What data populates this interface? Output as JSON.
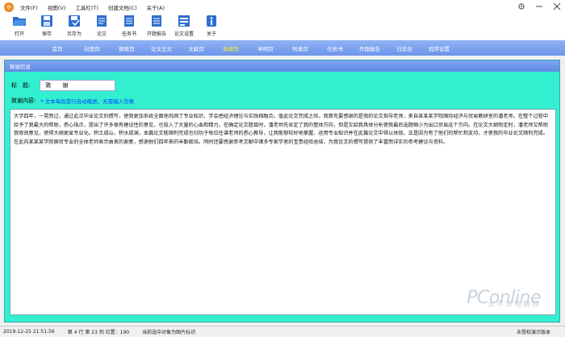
{
  "menu": {
    "logo_letter": "小",
    "items": [
      "文件(F)",
      "视图(V)",
      "工具栏(T)",
      "创建文档(C)",
      "关于(A)"
    ]
  },
  "toolbar": {
    "items": [
      {
        "label": "打开",
        "icon": "folder-open-icon"
      },
      {
        "label": "保存",
        "icon": "save-icon"
      },
      {
        "label": "另存为",
        "icon": "save-as-icon"
      },
      {
        "label": "论文",
        "icon": "document-icon"
      },
      {
        "label": "任务书",
        "icon": "task-book-icon"
      },
      {
        "label": "开题报告",
        "icon": "report-icon"
      },
      {
        "label": "论文设置",
        "icon": "settings-doc-icon"
      },
      {
        "label": "关于",
        "icon": "info-icon"
      }
    ]
  },
  "nav": {
    "items": [
      "首页",
      "封面页",
      "摘要页",
      "论文正文",
      "文献页",
      "致谢页",
      "申明页",
      "附录页",
      "任务书",
      "开题报告",
      "日志台",
      "程序设置"
    ],
    "active_index": 5
  },
  "panel": {
    "header": "致谢信息",
    "title_label": "标　题:",
    "title_value": "致　　谢",
    "content_label": "致谢内容:",
    "hint": "* 文本每段首行自动缩进，无需输入空格",
    "body": "大学四年，一晃而过，通过此次毕业论文的撰写，使我更加系统全面地巩固了专业知识，学会把经济理论与实践相融合。值此论文完成之际，我首先要感谢的是我的论文指导老师，来自某某某学院国际经济与贸易教研室的潘老师。在整个过程中给予了我最大的帮助，悉心指点，提出了许多很有建设性的意见，也投入了大量的心血和精力。在确定论文题目时，潘老师先肯定了我的整体方向，但是又給我具体分析使我最后选题缩小为出口贸易这个方向。在论文大纲制定时，潘老师又帮助我修改意见，使得大纲更显专业化。积土成山，积水成渊，本篇论文能顺利完成也归功于每位任课老师的悉心教导，让我能够较好地掌握、运用专业知识并在此篇论文中得以体现。正是因为有了他们的帮忙和支持，才使我的毕业论文顺利完成。在此向某某某学院国贸专业的全体老师表示由衷的谢意，感谢他们四年来的辛勤栽培。同时还要感谢参考文献中诸多专家学者的宝贵经验总结，为我论文的撰写提供了丰富而详实的参考建议与资料。",
    "watermark_main": "PConline",
    "watermark_sub": "太平洋电脑网"
  },
  "status": {
    "datetime": "2019-12-25 21:51:56",
    "position": "第 4 行 第 23 列 位置：190",
    "message": "当前选中对象为图片标识",
    "mode": "未授权演示版本"
  },
  "colors": {
    "nav_active": "#ffee33",
    "panel_bg": "#31efcf",
    "hint": "#0044ff"
  }
}
